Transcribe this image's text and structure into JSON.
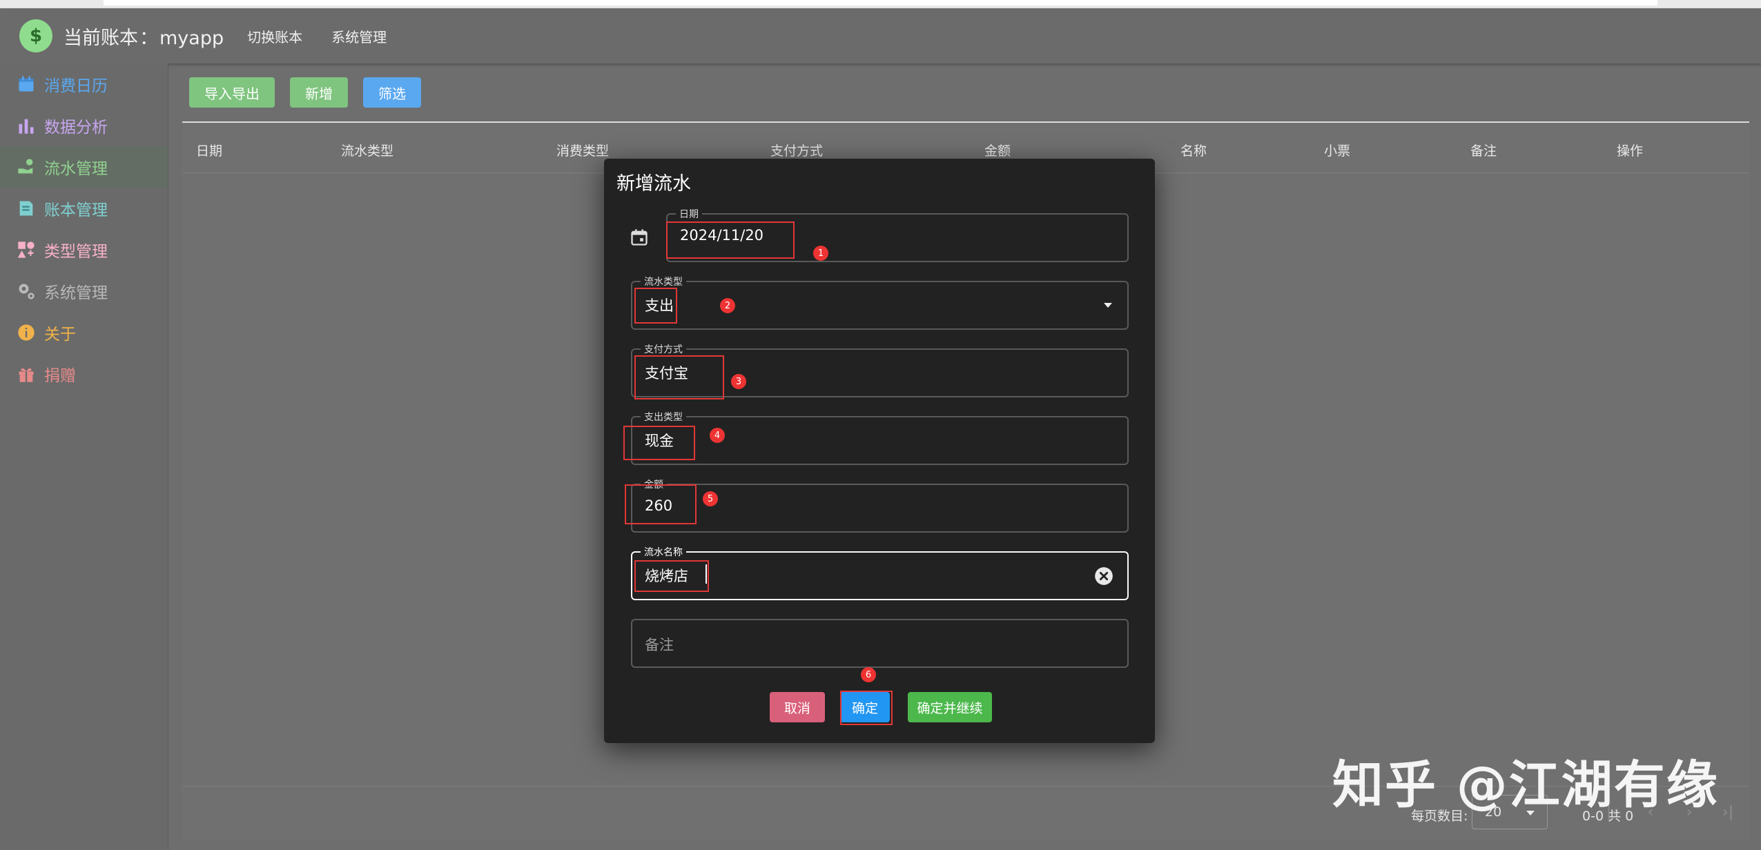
{
  "header": {
    "title_prefix": "当前账本",
    "title_sep": "：",
    "book_name": "myapp",
    "menu": [
      "切换账本",
      "系统管理"
    ]
  },
  "sidebar": {
    "items": [
      {
        "label": "消费日历",
        "icon": "calendar-icon",
        "color": "#5aa8f0"
      },
      {
        "label": "数据分析",
        "icon": "bar-chart-icon",
        "color": "#c7a6ef"
      },
      {
        "label": "流水管理",
        "icon": "hand-coins-icon",
        "color": "#8fd18f"
      },
      {
        "label": "账本管理",
        "icon": "ledger-icon",
        "color": "#7fcfcf"
      },
      {
        "label": "类型管理",
        "icon": "shapes-icon",
        "color": "#f6b0c8"
      },
      {
        "label": "系统管理",
        "icon": "gears-icon",
        "color": "#b8b8b8"
      },
      {
        "label": "关于",
        "icon": "info-icon",
        "color": "#f0b24a"
      },
      {
        "label": "捐赠",
        "icon": "gift-icon",
        "color": "#e88a8a"
      }
    ],
    "active_index": 2
  },
  "toolbar": {
    "import_export": "导入导出",
    "add": "新增",
    "filter": "筛选"
  },
  "table": {
    "columns": [
      "日期",
      "流水类型",
      "消费类型",
      "支付方式",
      "金额",
      "名称",
      "小票",
      "备注",
      "操作"
    ]
  },
  "pager": {
    "rows_per_page_label": "每页数目:",
    "rows_per_page": "20",
    "range": "0-0 共 0"
  },
  "dialog": {
    "title": "新增流水",
    "fields": {
      "date": {
        "label": "日期",
        "value": "2024/11/20"
      },
      "flow_type": {
        "label": "流水类型",
        "value": "支出"
      },
      "payment": {
        "label": "支付方式",
        "value": "支付宝"
      },
      "expense_type": {
        "label": "支出类型",
        "value": "现金"
      },
      "amount": {
        "label": "金额",
        "value": "260"
      },
      "name": {
        "label": "流水名称",
        "value": "烧烤店"
      },
      "note": {
        "placeholder": "备注"
      }
    },
    "buttons": {
      "cancel": "取消",
      "confirm": "确定",
      "confirm_continue": "确定并继续"
    },
    "annotations": [
      "1",
      "2",
      "3",
      "4",
      "5",
      "6"
    ]
  },
  "watermark": "知乎 @江湖有缘",
  "colors": {
    "green": "#7fc47f",
    "blue": "#5aa8f0",
    "cancel": "#d9607a",
    "confirm_continue": "#4cb84c",
    "annotation_red": "#e43737"
  }
}
